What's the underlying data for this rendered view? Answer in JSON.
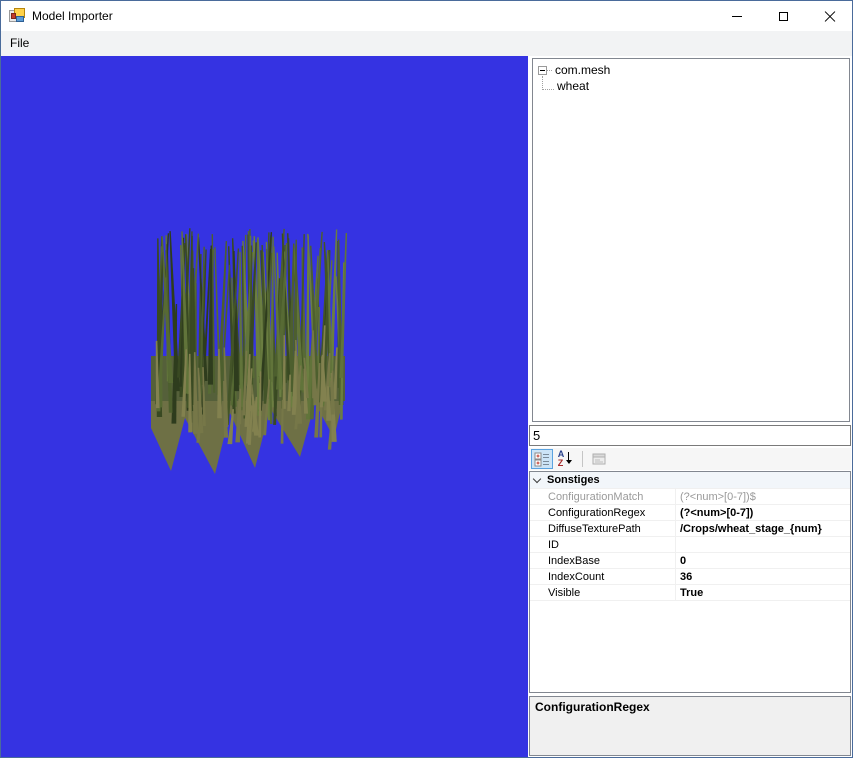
{
  "window": {
    "title": "Model Importer",
    "controls": {
      "minimize": "minimize",
      "maximize": "maximize",
      "close": "close"
    }
  },
  "menu": {
    "items": [
      {
        "label": "File"
      }
    ]
  },
  "viewport": {
    "background_color": "#3533e2",
    "model_name": "wheat",
    "description": "crossed-billboard wheat/grass 3D model on solid blue background"
  },
  "tree": {
    "items": [
      {
        "label": "com.mesh",
        "level": 0,
        "expanded": true
      },
      {
        "label": "wheat",
        "level": 1
      }
    ]
  },
  "stage_input": {
    "value": "5"
  },
  "toolbar": {
    "az_icon": {
      "top": "A",
      "bottom": "Z"
    },
    "buttons": [
      {
        "name": "categorized",
        "selected": true
      },
      {
        "name": "alphabetical",
        "selected": false
      },
      {
        "name": "property-pages",
        "disabled": true
      }
    ]
  },
  "property_grid": {
    "category": "Sonstiges",
    "rows": [
      {
        "name": "ConfigurationMatch",
        "value": "(?<num>[0-7])$",
        "state": "disabled"
      },
      {
        "name": "ConfigurationRegex",
        "value": "(?<num>[0-7])",
        "state": "modified"
      },
      {
        "name": "DiffuseTexturePath",
        "value": "/Crops/wheat_stage_{num}",
        "state": "modified"
      },
      {
        "name": "ID",
        "value": "",
        "state": "normal"
      },
      {
        "name": "IndexBase",
        "value": "0",
        "state": "modified"
      },
      {
        "name": "IndexCount",
        "value": "36",
        "state": "modified"
      },
      {
        "name": "Visible",
        "value": "True",
        "state": "modified"
      }
    ],
    "help": {
      "title": "ConfigurationRegex"
    }
  },
  "colors": {
    "window_border": "#4a6b9b",
    "viewport_blue": "#3533e2",
    "toolbar_selected_bg": "#cce4f7",
    "toolbar_selected_border": "#5ba3e0",
    "category_bg": "#f2f6fa",
    "grid_line": "#f0f0f0",
    "help_bg": "#f0f0f0",
    "grass_palette": [
      "#2e3c1d",
      "#394922",
      "#435428",
      "#4d5f2e",
      "#576a34",
      "#61743a",
      "#6b7e41",
      "#767748",
      "#82814f"
    ]
  }
}
